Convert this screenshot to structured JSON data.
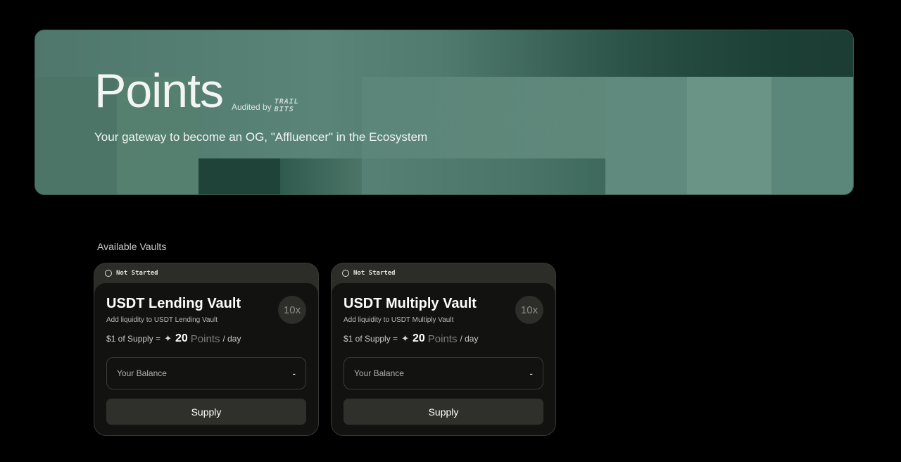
{
  "hero": {
    "title": "Points",
    "audited_label": "Audited by",
    "auditor_logo_line1": "TRAIL",
    "auditor_logo_line2": "BITS",
    "subtitle": "Your gateway to become an OG, \"Affluencer\" in the Ecosystem"
  },
  "vaults_section": {
    "label": "Available Vaults"
  },
  "vaults": [
    {
      "status": "Not Started",
      "title": "USDT Lending Vault",
      "description": "Add liquidity to USDT Lending Vault",
      "multiplier": "10x",
      "rate_prefix": "$1 of Supply =",
      "rate_icon": "sparkle-icon",
      "rate_value": "20",
      "rate_unit": "Points",
      "rate_suffix": "/ day",
      "balance_label": "Your Balance",
      "balance_value": "-",
      "supply_label": "Supply"
    },
    {
      "status": "Not Started",
      "title": "USDT Multiply Vault",
      "description": "Add liquidity to USDT Multiply Vault",
      "multiplier": "10x",
      "rate_prefix": "$1 of Supply =",
      "rate_icon": "sparkle-icon",
      "rate_value": "20",
      "rate_unit": "Points",
      "rate_suffix": "/ day",
      "balance_label": "Your Balance",
      "balance_value": "-",
      "supply_label": "Supply"
    }
  ],
  "colors": {
    "background": "#000000",
    "hero_green": "#5a8478",
    "card_frame": "#2c2c28",
    "card_body": "#121211",
    "button": "#2f2f2b"
  }
}
